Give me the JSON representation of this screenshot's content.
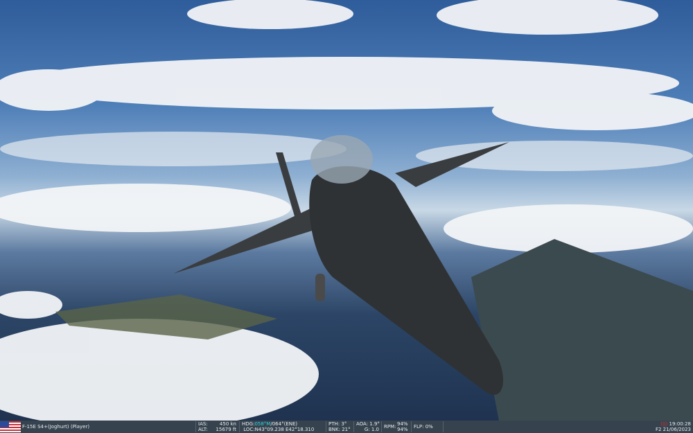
{
  "status_bar": {
    "unit": "F-15E S4+(Joghurt) (Player)",
    "ias_label": "IAS:",
    "ias": "450 kn",
    "alt_label": "ALT:",
    "alt": "15679 ft",
    "hdg_label": "HDG:",
    "hdg_mag": "058°M",
    "hdg_true": "/064°(ENE)",
    "loc_label": "LOC:",
    "loc": "N43°09.238 E42°18.310",
    "pth": "PTH: 3°",
    "bnk": "BNK: 21°",
    "aoa": "AOA: 1.9°",
    "g": "G: 1.0",
    "rpm_label": "RPM:",
    "rpm1": "94%",
    "rpm2": "94%",
    "flp": "FLP: 0%",
    "pause_indicator": "(||)",
    "time": "19:00:28",
    "date": "F2 21/06/2023"
  },
  "colors": {
    "bar": "#36434f",
    "accent": "#2fd3e0"
  }
}
